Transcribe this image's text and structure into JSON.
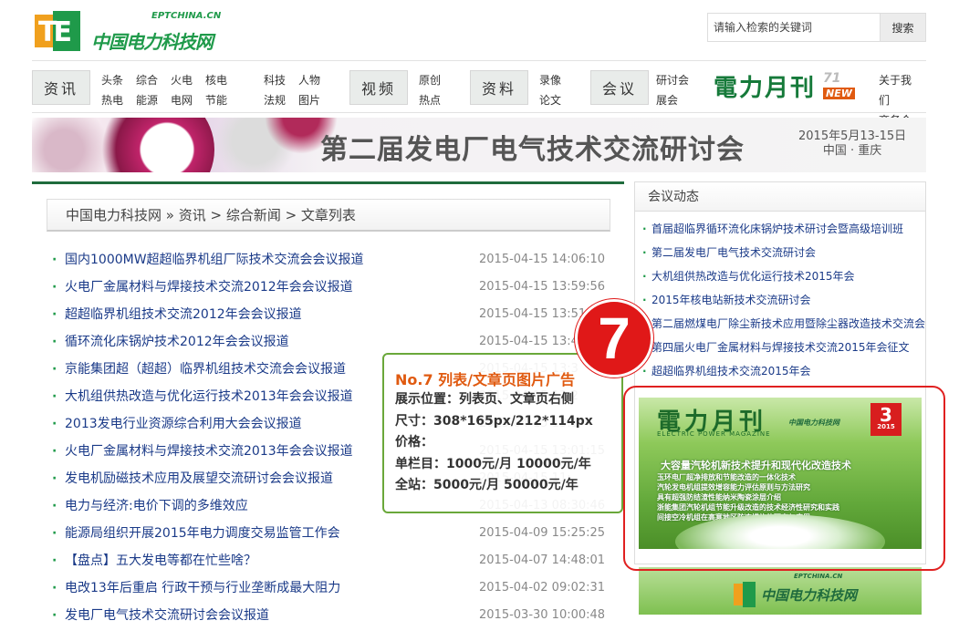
{
  "header": {
    "logo_cn": "中国电力科技网",
    "logo_en": "EPTCHINA.CN",
    "search_placeholder": "请输入检索的关键词",
    "search_button": "搜索"
  },
  "nav": {
    "sections": [
      {
        "label": "资讯",
        "links": [
          [
            "头条",
            "综合",
            "火电",
            "核电"
          ],
          [
            "热电",
            "能源",
            "电网",
            "节能"
          ],
          [
            "科技",
            "人物"
          ],
          [
            "法规",
            "图片"
          ]
        ]
      },
      {
        "label": "视频",
        "links": [
          [
            "原创"
          ],
          [
            "热点"
          ]
        ]
      },
      {
        "label": "资料",
        "links": [
          [
            "录像"
          ],
          [
            "论文"
          ]
        ]
      },
      {
        "label": "会议",
        "links": [
          [
            "研讨会"
          ],
          [
            "展会"
          ]
        ]
      }
    ],
    "magazine_logo": "電力月刊",
    "magazine_num": "71",
    "magazine_new": "NEW",
    "about": [
      "关于我们",
      "商务合作"
    ]
  },
  "banner": {
    "title": "第二届发电厂电气技术交流研讨会",
    "date": "2015年5月13-15日",
    "place": "中国 · 重庆"
  },
  "breadcrumb": "中国电力科技网 » 资讯 > 综合新闻 > 文章列表",
  "articles": [
    {
      "title": "国内1000MW超超临界机组厂际技术交流会会议报道",
      "date": "2015-04-15 14:06:10"
    },
    {
      "title": "火电厂金属材料与焊接技术交流2012年会会议报道",
      "date": "2015-04-15 13:59:56"
    },
    {
      "title": "超超临界机组技术交流2012年会会议报道",
      "date": "2015-04-15 13:51:"
    },
    {
      "title": "循环流化床锅炉技术2012年会会议报道",
      "date": "2015-04-15 13:4"
    },
    {
      "title": "京能集团超（超超）临界机组技术交流会会议报道",
      "date": "2015-04-15 13:3"
    },
    {
      "title": "大机组供热改造与优化运行技术2013年会会议报道",
      "date": "2015-04-15 13:2"
    },
    {
      "title": "2013发电行业资源综合利用大会会议报道",
      "date": "2015-04-15 13:1"
    },
    {
      "title": "火电厂金属材料与焊接技术交流2013年会会议报道",
      "date": "2015-04-15 13:01:15"
    },
    {
      "title": "发电机励磁技术应用及展望交流研讨会会议报道",
      "date": "2015-04-15 11:"
    },
    {
      "title": "电力与经济:电价下调的多维效应",
      "date": "2015-04-13 08:30:46"
    },
    {
      "title": "能源局组织开展2015年电力调度交易监管工作会",
      "date": "2015-04-09 15:25:25"
    },
    {
      "title": "【盘点】五大发电等都在忙些啥？",
      "date": "2015-04-07 14:48:01"
    },
    {
      "title": "电改13年后重启 行政干预与行业垄断成最大阻力",
      "date": "2015-04-02 09:02:31"
    },
    {
      "title": "发电厂电气技术交流研讨会会议报道",
      "date": "2015-03-30 10:00:48"
    }
  ],
  "sidebar": {
    "title": "会议动态",
    "events": [
      "首届超临界循环流化床锅炉技术研讨会暨高级培训班",
      "第二届发电厂电气技术交流研讨会",
      "大机组供热改造与优化运行技术2015年会",
      "2015年核电站新技术交流研讨会",
      "第二届燃煤电厂除尘新技术应用暨除尘器改造技术交流会",
      "第四届火电厂金属材料与焊接技术交流2015年会征文",
      "超超临界机组技术交流2015年会"
    ]
  },
  "magazine": {
    "title": "電力月刊",
    "subtitle": "ELECTRIC POWER MAGAZINE",
    "issue": "3",
    "issue_year": "2015",
    "headline": "大容量汽轮机新技术提升和现代化改造技术",
    "lines": [
      "玉环电厂超净排放和节能改造的一体化技术",
      "汽轮发电机组提效增容能力评估原则与方法研究",
      "具有超强防结渣性能纳米陶瓷涂层介绍",
      "浙能集团汽轮机组节能升级改造的技术经济性研究和实践",
      "间接空冷机组在高寒地区防冻措施的研究与应用"
    ],
    "logo_cn": "中国电力科技网",
    "logo_en": "EPTCHINA.CN"
  },
  "ad_overlay": {
    "badge": "7",
    "title": "No.7 列表/文章页图片广告",
    "lines": [
      "展示位置：列表页、文章页右侧",
      "尺寸：308*165px/212*114px",
      "价格：",
      "单栏目：1000元/月 10000元/年",
      "全站：5000元/月 50000元/年"
    ]
  },
  "colors": {
    "brand_green": "#1f9a4a",
    "accent_orange": "#e05a10",
    "badge_red": "#e01818",
    "link_blue": "#1a3a88"
  }
}
